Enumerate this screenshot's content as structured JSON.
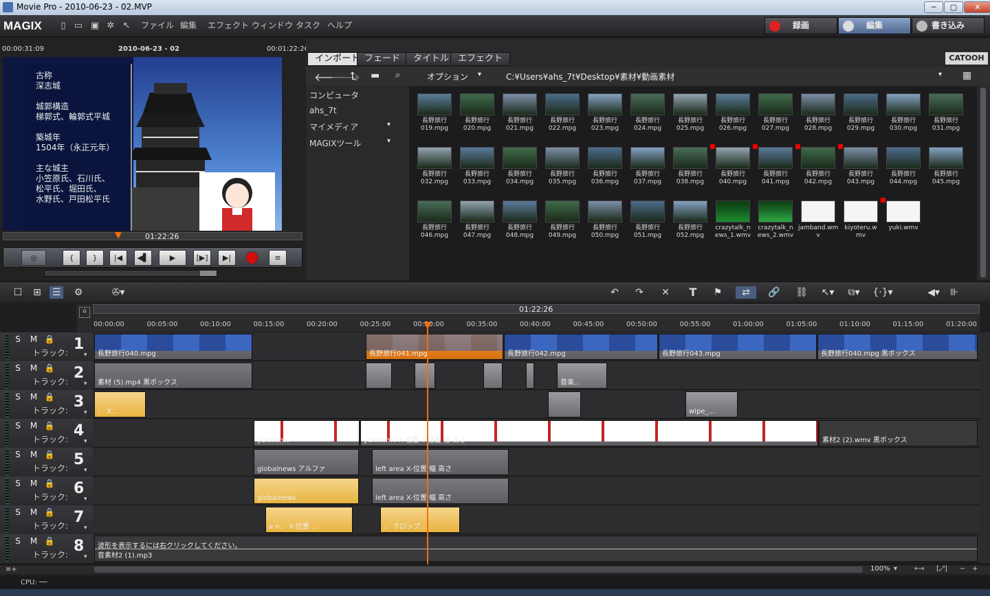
{
  "window": {
    "title": "Movie Pro - 2010-06-23 - 02.MVP",
    "min": "─",
    "max": "▢",
    "close": "✕"
  },
  "menubar": {
    "logo": "MAGIX",
    "items": [
      "ファイル",
      "編集",
      "エフェクト",
      "ウィンドウ",
      "タスク",
      "ヘルプ"
    ],
    "modes": [
      {
        "label": "録画",
        "active": false
      },
      {
        "label": "編集",
        "active": true
      },
      {
        "label": "書き込み",
        "active": false
      }
    ]
  },
  "preview": {
    "time_left": "00:00:31:09",
    "project": "2010-06-23 - 02",
    "time_right": "00:01:22:26",
    "cursor_time": "01:22:26",
    "overlay_lines": [
      "古称",
      "深志城",
      "",
      "城郭構造",
      "梯郭式、輪郭式平城",
      "",
      "築城年",
      "1504年（永正元年）",
      "",
      "主な城主",
      "小笠原氏、石川氏、",
      "松平氏、堀田氏、",
      "水野氏、戸田松平氏"
    ],
    "transport": [
      "{",
      "}",
      "|◀",
      "◀▌",
      "▶",
      "[▶]",
      "▶|"
    ]
  },
  "pool": {
    "tabs": [
      "インポート",
      "フェード",
      "タイトル",
      "エフェクト"
    ],
    "brand": "CATOOH",
    "options_label": "オプション",
    "path": "C:¥Users¥ahs_7t¥Desktop¥素材¥動画素材",
    "nav": [
      "コンピュータ",
      "ahs_7t",
      "マイメディア",
      "MAGIXツール"
    ],
    "rows": [
      [
        "長野旅行\n019.mpg",
        "長野旅行\n020.mpg",
        "長野旅行\n021.mpg",
        "長野旅行\n022.mpg",
        "長野旅行\n023.mpg",
        "長野旅行\n024.mpg",
        "長野旅行\n025.mpg",
        "長野旅行\n026.mpg",
        "長野旅行\n027.mpg",
        "長野旅行\n028.mpg",
        "長野旅行\n029.mpg",
        "長野旅行\n030.mpg",
        "長野旅行\n031.mpg"
      ],
      [
        "長野旅行\n032.mpg",
        "長野旅行\n033.mpg",
        "長野旅行\n034.mpg",
        "長野旅行\n035.mpg",
        "長野旅行\n036.mpg",
        "長野旅行\n037.mpg",
        "長野旅行\n038.mpg",
        "長野旅行\n040.mpg",
        "長野旅行\n041.mpg",
        "長野旅行\n042.mpg",
        "長野旅行\n043.mpg",
        "長野旅行\n044.mpg",
        "長野旅行\n045.mpg"
      ],
      [
        "長野旅行\n046.mpg",
        "長野旅行\n047.mpg",
        "長野旅行\n048.mpg",
        "長野旅行\n049.mpg",
        "長野旅行\n050.mpg",
        "長野旅行\n051.mpg",
        "長野旅行\n052.mpg",
        "crazytalk_n\news_1.wmv",
        "crazytalk_n\news_2.wmv",
        "jamband.wm\nv",
        "kiyoteru.w\nmv",
        "yuki.wmv"
      ]
    ]
  },
  "timeline": {
    "cursor_time": "01:22:26",
    "ticks": [
      "00:00:00",
      "00:05:00",
      "00:10:00",
      "00:15:00",
      "00:20:00",
      "00:25:00",
      "00:30:00",
      "00:35:00",
      "00:40:00",
      "00:45:00",
      "00:50:00",
      "00:55:00",
      "01:00:00",
      "01:05:00",
      "01:10:00",
      "01:15:00",
      "01:20:00"
    ],
    "track_label": "トラック:",
    "tracks": [
      {
        "num": "1",
        "clips": [
          "長野旅行040.mpg",
          "長野旅行041.mpg",
          "長野旅行042.mpg",
          "長野旅行043.mpg",
          "長野旅行040.mpg 黒ボックス"
        ]
      },
      {
        "num": "2",
        "clips": [
          "素材 (5).mp4 黒ボックス",
          "音楽..."
        ]
      },
      {
        "num": "3",
        "clips": [
          "、 X...",
          "wipe_..."
        ]
      },
      {
        "num": "4",
        "clips": [
          "yuki.wmv",
          "yuki.wmv  X-位置  Y-位置  幅  高さ",
          "素材2 (2).wmv 黒ボックス"
        ]
      },
      {
        "num": "5",
        "clips": [
          "globalnews アルファ",
          "left area  X-位置  幅  高さ"
        ]
      },
      {
        "num": "6",
        "clips": [
          "globalnews",
          "left area  X-位置  幅  高さ"
        ]
      },
      {
        "num": "7",
        "clips": [
          "a  n、 X-位置 ...",
          "、 クロップ..."
        ]
      },
      {
        "num": "8",
        "clips": [
          "波形を表示するには右クリックしてください。",
          "音素材2 (1).mp3"
        ]
      }
    ],
    "zoom": "100%"
  },
  "status": {
    "cpu": "CPU: ──"
  }
}
